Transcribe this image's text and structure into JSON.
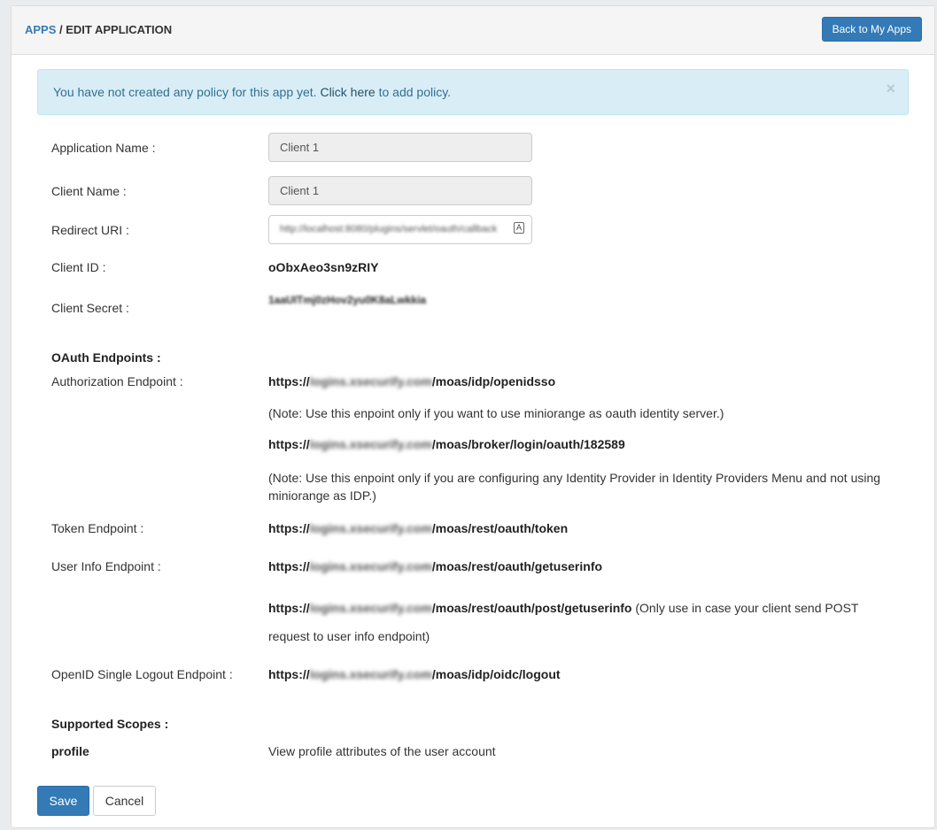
{
  "header": {
    "crumb_apps": "APPS",
    "crumb_sep": " / ",
    "crumb_page": "EDIT APPLICATION",
    "back_button": "Back to My Apps"
  },
  "alert": {
    "text_before": "You have not created any policy for this app yet. ",
    "link": "Click here",
    "text_after": " to add policy.",
    "close": "×"
  },
  "form": {
    "app_name_label": "Application Name :",
    "app_name_value": "Client 1",
    "client_name_label": "Client Name :",
    "client_name_value": "Client 1",
    "redirect_label": "Redirect URI :",
    "redirect_value": "http://localhost:8080/plugins/servlet/oauth/callback",
    "client_id_label": "Client ID :",
    "client_id_value": "oObxAeo3sn9zRIY",
    "client_secret_label": "Client Secret :",
    "client_secret_value": "1aaUITmj0zHov2yu0K8aLwkkia"
  },
  "endpoints": {
    "heading": "OAuth Endpoints :",
    "auth_label": "Authorization Endpoint :",
    "auth_url_prefix": "https://",
    "auth_url_host": "logins.xsecurify.com",
    "auth_url_path": "/moas/idp/openidsso",
    "auth_note": "(Note: Use this enpoint only if you want to use miniorange as oauth identity server.)",
    "broker_url_prefix": "https://",
    "broker_url_host": "logins.xsecurify.com",
    "broker_url_path": "/moas/broker/login/oauth/182589",
    "broker_note_line1": "(Note: Use this enpoint only if you are configuring any Identity Provider in Identity Providers Menu and not using",
    "broker_note_line2": "miniorange as IDP.)",
    "token_label": "Token Endpoint :",
    "token_url_prefix": "https://",
    "token_url_host": "logins.xsecurify.com",
    "token_url_path": "/moas/rest/oauth/token",
    "userinfo_label": "User Info Endpoint :",
    "userinfo_url_prefix": "https://",
    "userinfo_url_host": "logins.xsecurify.com",
    "userinfo_url_path": "/moas/rest/oauth/getuserinfo",
    "userinfo_post_prefix": "https://",
    "userinfo_post_host": "logins.xsecurify.com",
    "userinfo_post_path": "/moas/rest/oauth/post/getuserinfo",
    "userinfo_post_note1": " (Only use in case your client send POST",
    "userinfo_post_note2": "request to user info endpoint)",
    "logout_label": "OpenID Single Logout Endpoint :",
    "logout_url_prefix": "https://",
    "logout_url_host": "logins.xsecurify.com",
    "logout_url_path": "/moas/idp/oidc/logout"
  },
  "scopes": {
    "heading": "Supported Scopes :",
    "name": "profile",
    "description": "View profile attributes of the user account"
  },
  "actions": {
    "save": "Save",
    "cancel": "Cancel"
  }
}
